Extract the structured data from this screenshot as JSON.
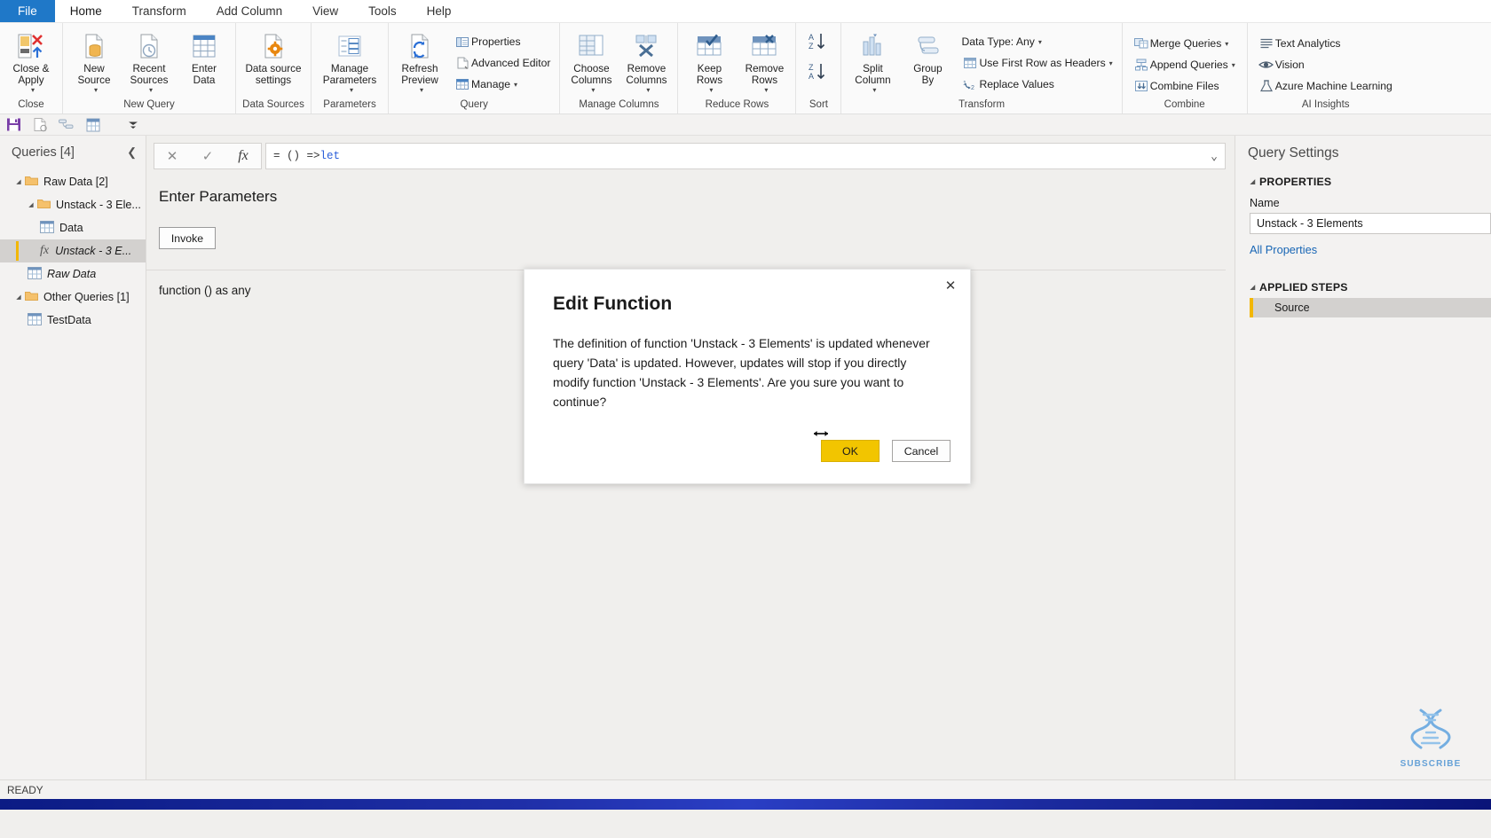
{
  "ribbon": {
    "tabs": [
      {
        "label": "File",
        "type": "file"
      },
      {
        "label": "Home",
        "type": "active"
      },
      {
        "label": "Transform",
        "type": "normal"
      },
      {
        "label": "Add Column",
        "type": "normal"
      },
      {
        "label": "View",
        "type": "normal"
      },
      {
        "label": "Tools",
        "type": "normal"
      },
      {
        "label": "Help",
        "type": "normal"
      }
    ],
    "groups": [
      {
        "label": "Close",
        "big": [
          {
            "name": "close-and-apply",
            "label": "Close &\nApply",
            "icon": "close-apply-icon",
            "caret": true
          }
        ],
        "small": []
      },
      {
        "label": "New Query",
        "big": [
          {
            "name": "new-source",
            "label": "New\nSource",
            "icon": "new-source-icon",
            "caret": true
          },
          {
            "name": "recent-sources",
            "label": "Recent\nSources",
            "icon": "recent-sources-icon",
            "caret": true
          },
          {
            "name": "enter-data",
            "label": "Enter\nData",
            "icon": "enter-data-icon",
            "caret": false
          }
        ],
        "small": []
      },
      {
        "label": "Data Sources",
        "big": [
          {
            "name": "data-source-settings",
            "label": "Data source\nsettings",
            "icon": "data-source-settings-icon",
            "caret": false
          }
        ],
        "small": []
      },
      {
        "label": "Parameters",
        "big": [
          {
            "name": "manage-parameters",
            "label": "Manage\nParameters",
            "icon": "manage-parameters-icon",
            "caret": true
          }
        ],
        "small": []
      },
      {
        "label": "Query",
        "big": [
          {
            "name": "refresh-preview",
            "label": "Refresh\nPreview",
            "icon": "refresh-preview-icon",
            "caret": true
          }
        ],
        "small": [
          {
            "name": "properties",
            "label": "Properties",
            "icon": "properties-icon",
            "caret": false
          },
          {
            "name": "advanced-editor",
            "label": "Advanced Editor",
            "icon": "advanced-editor-icon",
            "caret": false
          },
          {
            "name": "manage",
            "label": "Manage",
            "icon": "manage-icon",
            "caret": true
          }
        ]
      },
      {
        "label": "Manage Columns",
        "big": [
          {
            "name": "choose-columns",
            "label": "Choose\nColumns",
            "icon": "choose-columns-icon",
            "caret": true
          },
          {
            "name": "remove-columns",
            "label": "Remove\nColumns",
            "icon": "remove-columns-icon",
            "caret": true
          }
        ],
        "small": []
      },
      {
        "label": "Reduce Rows",
        "big": [
          {
            "name": "keep-rows",
            "label": "Keep\nRows",
            "icon": "keep-rows-icon",
            "caret": true
          },
          {
            "name": "remove-rows",
            "label": "Remove\nRows",
            "icon": "remove-rows-icon",
            "caret": true
          }
        ],
        "small": []
      },
      {
        "label": "Sort",
        "big": [],
        "sort": [
          {
            "name": "sort-ascending",
            "label": "AZ"
          },
          {
            "name": "sort-descending",
            "label": "ZA"
          }
        ],
        "small": []
      },
      {
        "label": "Transform",
        "big": [
          {
            "name": "split-column",
            "label": "Split\nColumn",
            "icon": "split-column-icon",
            "caret": true
          },
          {
            "name": "group-by",
            "label": "Group\nBy",
            "icon": "group-by-icon",
            "caret": false
          }
        ],
        "small": [
          {
            "name": "data-type",
            "label": "Data Type: Any",
            "icon": "none",
            "caret": true
          },
          {
            "name": "use-first-row-as-headers",
            "label": "Use First Row as Headers",
            "icon": "first-row-headers-icon",
            "caret": true
          },
          {
            "name": "replace-values",
            "label": "Replace Values",
            "icon": "replace-values-icon",
            "caret": false
          }
        ]
      },
      {
        "label": "Combine",
        "big": [],
        "small": [
          {
            "name": "merge-queries",
            "label": "Merge Queries",
            "icon": "merge-queries-icon",
            "caret": true
          },
          {
            "name": "append-queries",
            "label": "Append Queries",
            "icon": "append-queries-icon",
            "caret": true
          },
          {
            "name": "combine-files",
            "label": "Combine Files",
            "icon": "combine-files-icon",
            "caret": false
          }
        ]
      },
      {
        "label": "AI Insights",
        "big": [],
        "small": [
          {
            "name": "text-analytics",
            "label": "Text Analytics",
            "icon": "text-analytics-icon",
            "caret": false
          },
          {
            "name": "vision",
            "label": "Vision",
            "icon": "vision-icon",
            "caret": false
          },
          {
            "name": "azure-machine-learning",
            "label": "Azure Machine Learning",
            "icon": "azure-ml-icon",
            "caret": false
          }
        ]
      }
    ]
  },
  "quick_access": [
    {
      "name": "save-icon"
    },
    {
      "name": "new-query-icon"
    },
    {
      "name": "merge-icon"
    },
    {
      "name": "table-icon"
    },
    {
      "name": "customize-qat-icon"
    }
  ],
  "queries_pane": {
    "title": "Queries [4]",
    "collapse_icon": "chevron-left-icon",
    "tree": [
      {
        "label": "Raw Data [2]",
        "kind": "folder",
        "indent": 0,
        "expanded": true,
        "selected": false,
        "italic": false
      },
      {
        "label": "Unstack - 3 Ele...",
        "kind": "folder",
        "indent": 1,
        "expanded": true,
        "selected": false,
        "italic": false
      },
      {
        "label": "Data",
        "kind": "table",
        "indent": 2,
        "expanded": false,
        "selected": false,
        "italic": false
      },
      {
        "label": "Unstack - 3 E...",
        "kind": "function",
        "indent": 2,
        "expanded": false,
        "selected": true,
        "italic": true
      },
      {
        "label": "Raw Data",
        "kind": "table",
        "indent": 1,
        "expanded": false,
        "selected": false,
        "italic": true
      },
      {
        "label": "Other Queries [1]",
        "kind": "folder",
        "indent": 0,
        "expanded": true,
        "selected": false,
        "italic": false
      },
      {
        "label": "TestData",
        "kind": "table",
        "indent": 1,
        "expanded": false,
        "selected": false,
        "italic": false
      }
    ]
  },
  "formula_bar": {
    "cancel_icon": "cancel-icon",
    "accept_icon": "checkmark-icon",
    "fx_icon": "fx-icon",
    "prefix": "= () => ",
    "keyword": "let",
    "expand_icon": "chevron-down-icon"
  },
  "function_view": {
    "heading": "Enter Parameters",
    "invoke_label": "Invoke",
    "signature": "function () as any"
  },
  "query_settings": {
    "title": "Query Settings",
    "properties_label": "PROPERTIES",
    "name_label": "Name",
    "name_value": "Unstack - 3 Elements",
    "all_properties_link": "All Properties",
    "applied_steps_label": "APPLIED STEPS",
    "steps": [
      {
        "label": "Source"
      }
    ]
  },
  "watermark": {
    "icon": "dna-helix-icon",
    "text": "SUBSCRIBE"
  },
  "status_bar": {
    "text": "READY"
  },
  "dialog": {
    "title": "Edit Function",
    "close_icon": "close-icon",
    "message": "The definition of function 'Unstack - 3 Elements' is updated whenever query 'Data' is updated. However, updates will stop if you directly modify function 'Unstack - 3 Elements'. Are you sure you want to continue?",
    "ok_label": "OK",
    "cancel_label": "Cancel",
    "cursor_icon": "horizontal-resize-cursor"
  },
  "colors": {
    "file_tab": "#1f78c8",
    "primary_button": "#f2c500",
    "accent_bar": "#f2b705",
    "link": "#1866b5",
    "folder": "#f5c16c"
  }
}
